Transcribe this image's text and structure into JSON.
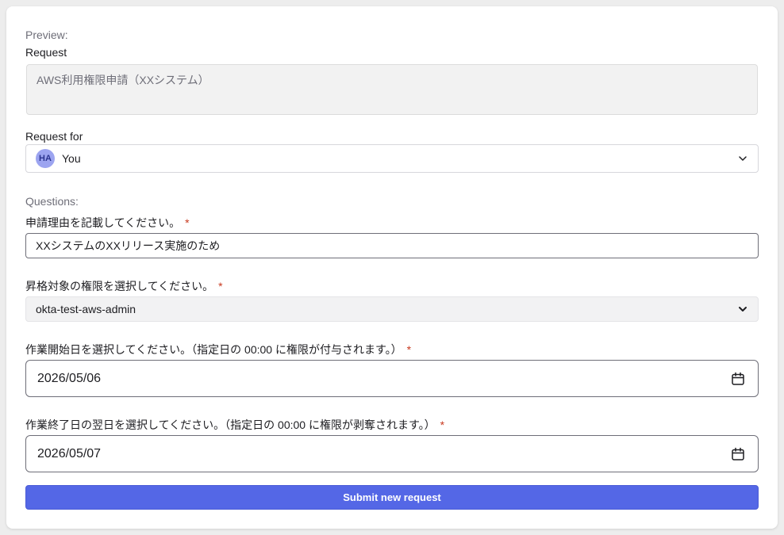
{
  "preview": {
    "section_label": "Preview:",
    "request_label": "Request",
    "request_value": "AWS利用権限申請（XXシステム）"
  },
  "request_for": {
    "label": "Request for",
    "avatar_initials": "HA",
    "selected": "You"
  },
  "questions": {
    "section_label": "Questions:",
    "q1": {
      "label": "申請理由を記載してください。",
      "required_mark": "*",
      "value": "XXシステムのXXリリース実施のため"
    },
    "q2": {
      "label": "昇格対象の権限を選択してください。",
      "required_mark": "*",
      "value": "okta-test-aws-admin"
    },
    "q3": {
      "label": "作業開始日を選択してください。（指定日の 00:00 に権限が付与されます。）",
      "required_mark": "*",
      "value": "2026/05/06"
    },
    "q4": {
      "label": "作業終了日の翌日を選択してください。（指定日の 00:00 に権限が剥奪されます。）",
      "required_mark": "*",
      "value": "2026/05/07"
    }
  },
  "submit_label": "Submit new request",
  "colors": {
    "accent": "#5467e6",
    "required": "#c8391f",
    "avatar_bg": "#9ca4f0"
  },
  "icons": {
    "dropdown": "chevron-down-icon",
    "date": "calendar-icon"
  }
}
